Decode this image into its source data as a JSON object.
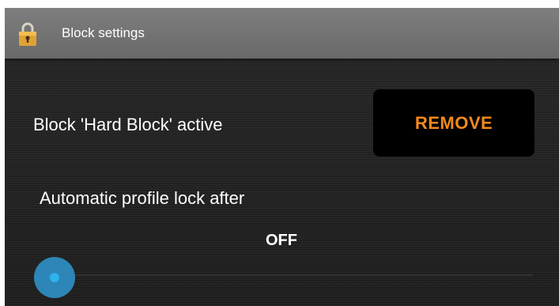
{
  "header": {
    "title": "Block settings",
    "icon": "padlock-icon"
  },
  "block": {
    "status_label": "Block 'Hard Block' active",
    "remove_label": "REMOVE"
  },
  "auto_lock": {
    "label": "Automatic profile lock after",
    "value": "OFF",
    "slider_level": 0
  },
  "colors": {
    "accent_orange": "#f08a1c",
    "slider_blue": "#2e86b8",
    "header_gray": "#747474",
    "background": "#232323"
  }
}
